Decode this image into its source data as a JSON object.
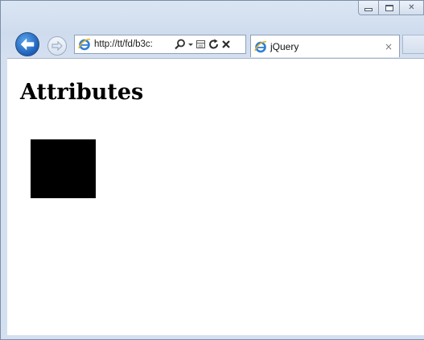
{
  "window": {
    "caption_buttons": [
      "minimize",
      "maximize",
      "close"
    ],
    "close_glyph": "✕"
  },
  "nav": {
    "address_url": "http://tt/fd/b3c:",
    "tab": {
      "title": "jQuery",
      "close_glyph": "×"
    }
  },
  "page": {
    "heading": "Attributes",
    "square_color": "#000000"
  },
  "icons": [
    "back-arrow-icon",
    "forward-arrow-icon",
    "ie-logo-icon",
    "search-icon",
    "dropdown-icon",
    "compatibility-view-icon",
    "refresh-icon",
    "stop-icon",
    "tab-close-icon"
  ]
}
